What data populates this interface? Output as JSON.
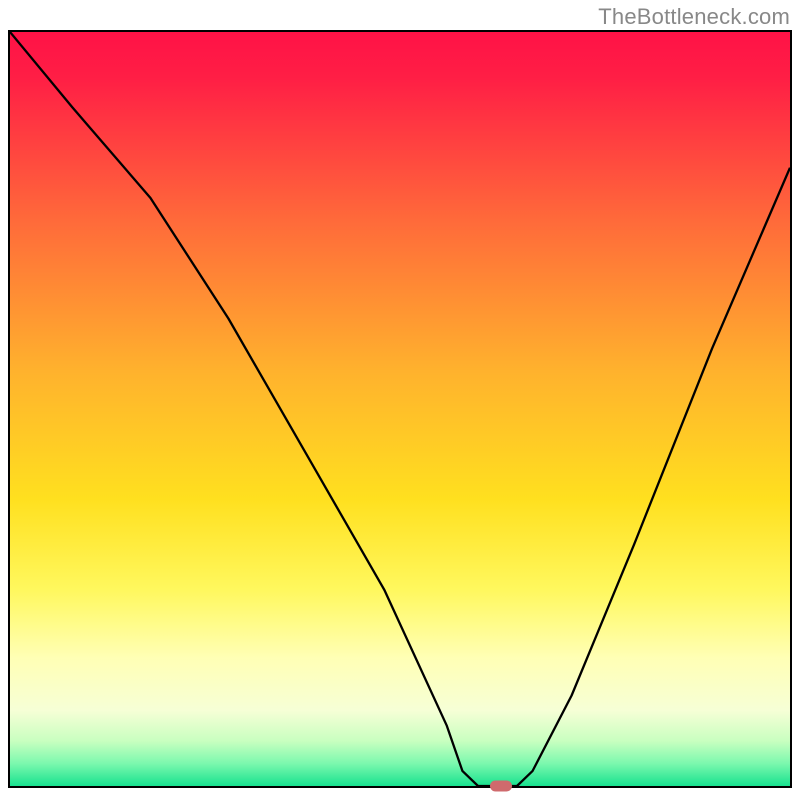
{
  "watermark": "TheBottleneck.com",
  "chart_data": {
    "type": "line",
    "title": "",
    "xlabel": "",
    "ylabel": "",
    "xlim": [
      0,
      100
    ],
    "ylim": [
      0,
      100
    ],
    "grid": false,
    "series": [
      {
        "name": "curve",
        "x": [
          0,
          8,
          18,
          28,
          38,
          48,
          56,
          58,
          60,
          62,
          65,
          67,
          72,
          80,
          90,
          100
        ],
        "y": [
          100,
          90,
          78,
          62,
          44,
          26,
          8,
          2,
          0,
          0,
          0,
          2,
          12,
          32,
          58,
          82
        ]
      }
    ],
    "marker": {
      "x": 63,
      "y": 0
    },
    "background_gradient_stops": [
      {
        "pos": 0,
        "color": "#ff1246"
      },
      {
        "pos": 0.06,
        "color": "#ff1e45"
      },
      {
        "pos": 0.25,
        "color": "#ff6a3a"
      },
      {
        "pos": 0.45,
        "color": "#ffb22d"
      },
      {
        "pos": 0.62,
        "color": "#ffe01f"
      },
      {
        "pos": 0.74,
        "color": "#fff85e"
      },
      {
        "pos": 0.83,
        "color": "#ffffb5"
      },
      {
        "pos": 0.9,
        "color": "#f6ffd6"
      },
      {
        "pos": 0.94,
        "color": "#c9ffc0"
      },
      {
        "pos": 0.97,
        "color": "#7cf8ae"
      },
      {
        "pos": 1.0,
        "color": "#18e28f"
      }
    ]
  }
}
